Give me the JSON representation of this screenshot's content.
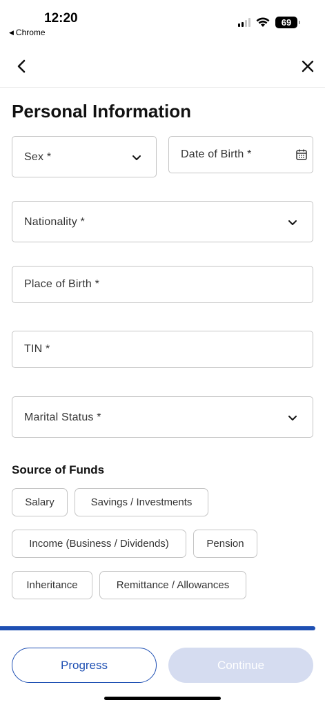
{
  "status_bar": {
    "time": "12:20",
    "back_app": "Chrome",
    "battery": "69"
  },
  "nav": {
    "back_icon": "chevron-left-icon",
    "close_icon": "close-icon"
  },
  "page_title": "Personal Information",
  "fields": {
    "sex": {
      "label": "Sex *",
      "icon": "chevron-down-icon"
    },
    "dob": {
      "label": "Date of Birth *",
      "icon": "calendar-icon"
    },
    "nationality": {
      "label": "Nationality *",
      "icon": "chevron-down-icon"
    },
    "place_of_birth": {
      "label": "Place of Birth *"
    },
    "tin": {
      "label": "TIN *"
    },
    "marital_status": {
      "label": "Marital Status *",
      "icon": "chevron-down-icon"
    }
  },
  "source_of_funds": {
    "title": "Source of Funds",
    "options": [
      "Salary",
      "Savings / Investments",
      "Income (Business / Dividends)",
      "Pension",
      "Inheritance",
      "Remittance / Allowances"
    ]
  },
  "footer": {
    "progress_label": "Progress",
    "continue_label": "Continue",
    "progress_fraction": 0.97
  },
  "colors": {
    "accent": "#1e4fb3",
    "disabled": "#d5dcf0",
    "border": "#c4c4c4"
  }
}
